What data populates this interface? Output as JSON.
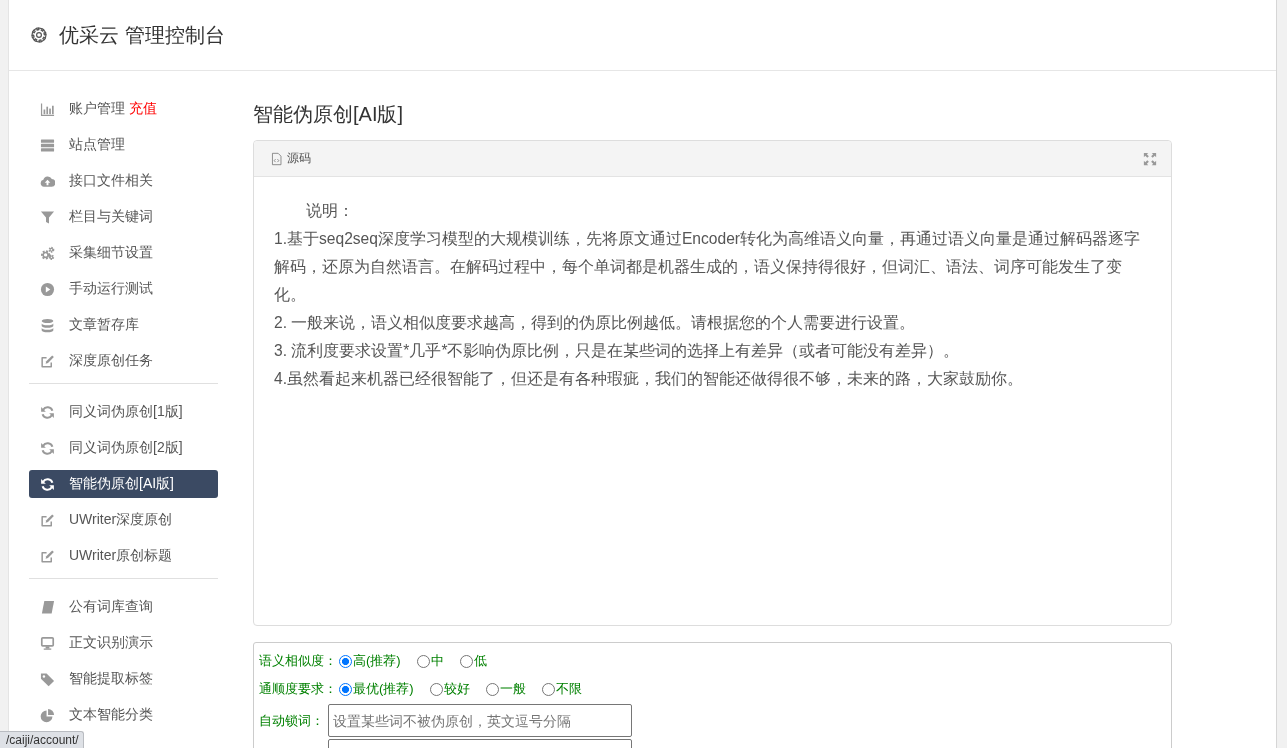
{
  "header": {
    "title": "优采云 管理控制台"
  },
  "sidebar": {
    "sections": [
      {
        "items": [
          {
            "label": "账户管理",
            "badge": "充值",
            "selected": false
          },
          {
            "label": "站点管理",
            "selected": false
          },
          {
            "label": "接口文件相关",
            "selected": false
          },
          {
            "label": "栏目与关键词",
            "selected": false
          },
          {
            "label": "采集细节设置",
            "selected": false
          },
          {
            "label": "手动运行测试",
            "selected": false
          },
          {
            "label": "文章暂存库",
            "selected": false
          },
          {
            "label": "深度原创任务",
            "selected": false
          }
        ]
      },
      {
        "items": [
          {
            "label": "同义词伪原创[1版]",
            "selected": false
          },
          {
            "label": "同义词伪原创[2版]",
            "selected": false
          },
          {
            "label": "智能伪原创[AI版]",
            "selected": true
          },
          {
            "label": "UWriter深度原创",
            "selected": false
          },
          {
            "label": "UWriter原创标题",
            "selected": false
          }
        ]
      },
      {
        "items": [
          {
            "label": "公有词库查询",
            "selected": false
          },
          {
            "label": "正文识别演示",
            "selected": false
          },
          {
            "label": "智能提取标签",
            "selected": false
          },
          {
            "label": "文本智能分类",
            "selected": false
          }
        ]
      }
    ]
  },
  "page": {
    "title": "智能伪原创[AI版]"
  },
  "editor": {
    "tab": "源码",
    "heading": "说明：",
    "paragraphs": [
      "1.基于seq2seq深度学习模型的大规模训练，先将原文通过Encoder转化为高维语义向量，再通过语义向量是通过解码器逐字解码，还原为自然语言。在解码过程中，每个单词都是机器生成的，语义保持得很好，但词汇、语法、词序可能发生了变化。",
      "2. 一般来说，语义相似度要求越高，得到的伪原比例越低。请根据您的个人需要进行设置。",
      "3. 流利度要求设置*几乎*不影响伪原比例，只是在某些词的选择上有差异（或者可能没有差异）。",
      "4.虽然看起来机器已经很智能了，但还是有各种瑕疵，我们的智能还做得很不够，未来的路，大家鼓励你。"
    ]
  },
  "options": {
    "rows": [
      {
        "kind": "radio",
        "label": "语义相似度：",
        "options": [
          {
            "label": "高(推荐)",
            "selected": true
          },
          {
            "label": "中",
            "selected": false
          },
          {
            "label": "低",
            "selected": false
          }
        ]
      },
      {
        "kind": "radio",
        "label": "通顺度要求：",
        "options": [
          {
            "label": "最优(推荐)",
            "selected": true
          },
          {
            "label": "较好",
            "selected": false
          },
          {
            "label": "一般",
            "selected": false
          },
          {
            "label": "不限",
            "selected": false
          }
        ]
      },
      {
        "kind": "text",
        "label": "自动锁词：",
        "placeholder": "设置某些词不被伪原创，英文逗号分隔"
      },
      {
        "kind": "text"
      }
    ]
  },
  "status_bar": {
    "url": "/caiji/account/"
  }
}
